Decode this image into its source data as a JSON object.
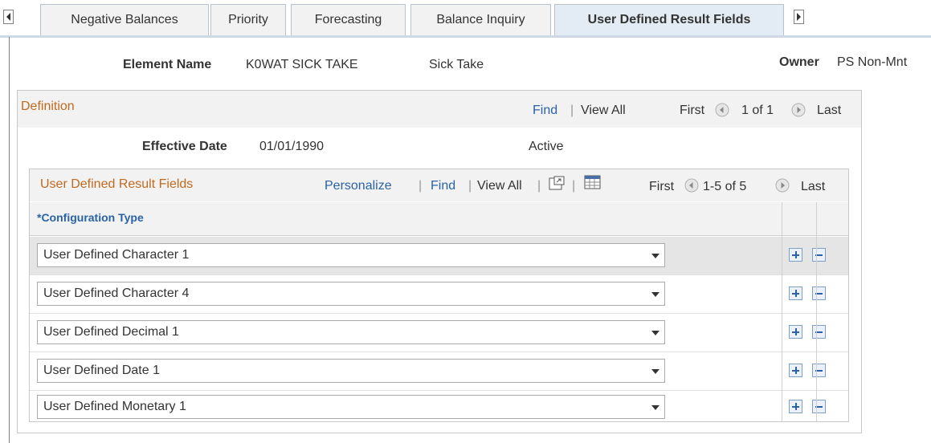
{
  "tabs": {
    "prev_icon": "left-arrow-icon",
    "next_icon": "right-arrow-icon",
    "items": [
      {
        "label": "Negative Balances"
      },
      {
        "label": "Priority"
      },
      {
        "label": "Forecasting"
      },
      {
        "label": "Balance Inquiry"
      },
      {
        "label": "User Defined Result Fields"
      }
    ]
  },
  "header": {
    "element_name_label": "Element Name",
    "element_name_value": "K0WAT SICK TAKE",
    "element_desc": "Sick Take",
    "owner_label": "Owner",
    "owner_value": "PS Non-Mnt"
  },
  "definition": {
    "title": "Definition",
    "find": "Find",
    "sep": "|",
    "view_all": "View All",
    "first": "First",
    "range": "1 of 1",
    "last": "Last",
    "effective_date_label": "Effective Date",
    "effective_date_value": "01/01/1990",
    "status": "Active"
  },
  "grid": {
    "title": "User Defined Result Fields",
    "personalize": "Personalize",
    "sep": "|",
    "find": "Find",
    "view_all": "View All",
    "first": "First",
    "range": "1-5 of 5",
    "last": "Last",
    "column_header": "*Configuration Type",
    "rows": [
      {
        "value": "User Defined Character 1"
      },
      {
        "value": "User Defined Character 4"
      },
      {
        "value": "User Defined Decimal 1"
      },
      {
        "value": "User Defined Date 1"
      },
      {
        "value": "User Defined Monetary 1"
      }
    ]
  },
  "colors": {
    "accent_link": "#2a62a6",
    "section_title": "#c06a20",
    "active_tab": "#e3ebf4"
  }
}
